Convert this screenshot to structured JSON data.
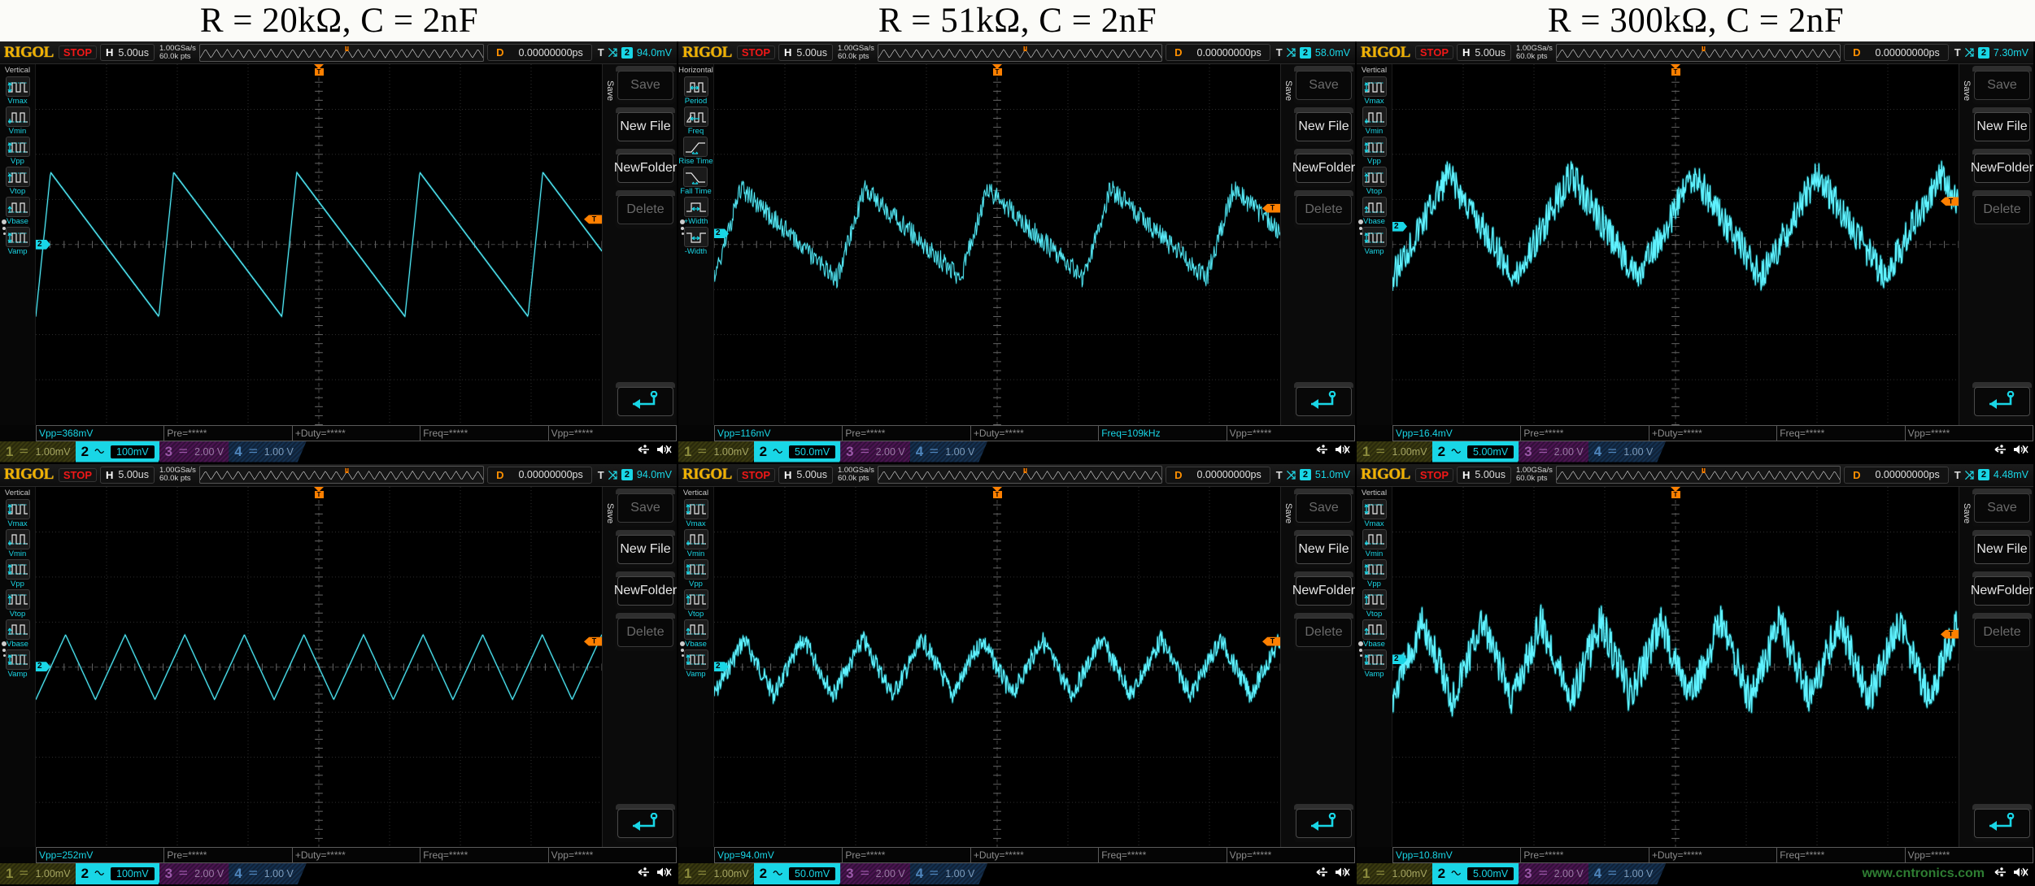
{
  "titles": [
    "R = 20kΩ, C = 2nF",
    "R = 51kΩ, C = 2nF",
    "R = 300kΩ, C = 2nF"
  ],
  "brand": "RIGOL",
  "common": {
    "run_state": "STOP",
    "h_label": "H",
    "h_value": "5.00us",
    "sample_rate": "1.00GSa/s",
    "mem_depth": "60.0k pts",
    "d_label": "D",
    "d_value": "0.00000000ps",
    "trigger_label": "T",
    "trigger_channel": "2",
    "trigger_slope": "rising-edge-icon",
    "measure_placeholder": "*****",
    "minimap_marker": "T"
  },
  "menus": {
    "vertical": {
      "title": "Vertical",
      "items": [
        {
          "label": "Vmax",
          "icon": "vmax-icon"
        },
        {
          "label": "Vmin",
          "icon": "vmin-icon"
        },
        {
          "label": "Vpp",
          "icon": "vpp-icon"
        },
        {
          "label": "Vtop",
          "icon": "vtop-icon"
        },
        {
          "label": "Vbase",
          "icon": "vbase-icon"
        },
        {
          "label": "Vamp",
          "icon": "vamp-icon"
        }
      ]
    },
    "horizontal": {
      "title": "Horizontal",
      "items": [
        {
          "label": "Period",
          "icon": "period-icon"
        },
        {
          "label": "Freq",
          "icon": "freq-icon"
        },
        {
          "label": "Rise Time",
          "icon": "rise-time-icon"
        },
        {
          "label": "Fall Time",
          "icon": "fall-time-icon"
        },
        {
          "label": "+Width",
          "icon": "pos-width-icon"
        },
        {
          "label": "-Width",
          "icon": "neg-width-icon"
        }
      ]
    },
    "save": {
      "tab": "Save",
      "keys": [
        {
          "label": "Save",
          "state": "disabled"
        },
        {
          "label": "New File",
          "state": "enabled"
        },
        {
          "label": "NewFolder",
          "state": "enabled"
        },
        {
          "label": "Delete",
          "state": "disabled"
        }
      ],
      "back_icon": "back-arrow-icon"
    }
  },
  "channels": [
    {
      "num": "1",
      "coupling": "dc-coupling-icon",
      "selected": false
    },
    {
      "num": "2",
      "coupling": "ac-coupling-icon",
      "selected": true
    },
    {
      "num": "3",
      "coupling": "dc-coupling-icon",
      "selected": false
    },
    {
      "num": "4",
      "coupling": "dc-coupling-icon",
      "selected": false
    }
  ],
  "sys_icons": [
    "usb-icon",
    "sound-mute-icon"
  ],
  "watermark": "www.cntronics.com",
  "scopes": [
    {
      "id": "scope-1",
      "position": "top-left",
      "trigger_level": "94.0mV",
      "left_menu": "vertical",
      "channel_scales": [
        "1.00mV",
        "100mV",
        "2.00 V",
        "1.00 V"
      ],
      "measurements": [
        {
          "label": "Vpp=",
          "value": "368mV",
          "active": true
        },
        {
          "label": "Pre=",
          "value": "*****",
          "active": false
        },
        {
          "label": "+Duty=",
          "value": "*****",
          "active": false
        },
        {
          "label": "Freq=",
          "value": "*****",
          "active": false
        },
        {
          "label": "Vpp=",
          "value": "*****",
          "active": false
        }
      ],
      "waveform": {
        "type": "sawtooth-falling",
        "cycles": 4.6,
        "amplitude_div": 1.6,
        "center_y": 0.5,
        "noise": 0.0,
        "thickness": 2.4,
        "duty_rise": 0.12
      }
    },
    {
      "id": "scope-2",
      "position": "top-middle",
      "trigger_level": "58.0mV",
      "left_menu": "horizontal",
      "channel_scales": [
        "1.00mV",
        "50.0mV",
        "2.00 V",
        "1.00 V"
      ],
      "measurements": [
        {
          "label": "Vpp=",
          "value": "116mV",
          "active": true
        },
        {
          "label": "Pre=",
          "value": "*****",
          "active": false
        },
        {
          "label": "+Duty=",
          "value": "*****",
          "active": false
        },
        {
          "label": "Freq=",
          "value": "109kHz",
          "active": true
        },
        {
          "label": "Vpp=",
          "value": "*****",
          "active": false
        }
      ],
      "waveform": {
        "type": "sawtooth-falling",
        "cycles": 4.6,
        "amplitude_div": 1.0,
        "center_y": 0.47,
        "noise": 0.055,
        "thickness": 2.0,
        "duty_rise": 0.22
      }
    },
    {
      "id": "scope-3",
      "position": "top-right",
      "trigger_level": "7.30mV",
      "left_menu": "vertical",
      "channel_scales": [
        "1.00mV",
        "5.00mV",
        "2.00 V",
        "1.00 V"
      ],
      "measurements": [
        {
          "label": "Vpp=",
          "value": "16.4mV",
          "active": true
        },
        {
          "label": "Pre=",
          "value": "*****",
          "active": false
        },
        {
          "label": "+Duty=",
          "value": "*****",
          "active": false
        },
        {
          "label": "Freq=",
          "value": "*****",
          "active": false
        },
        {
          "label": "Vpp=",
          "value": "*****",
          "active": false
        }
      ],
      "waveform": {
        "type": "triangle",
        "cycles": 4.6,
        "amplitude_div": 1.15,
        "center_y": 0.45,
        "noise": 0.09,
        "thickness": 3.2,
        "duty_rise": 0.45
      }
    },
    {
      "id": "scope-4",
      "position": "bottom-left",
      "trigger_level": "94.0mV",
      "left_menu": "vertical",
      "channel_scales": [
        "1.00mV",
        "100mV",
        "2.00 V",
        "1.00 V"
      ],
      "measurements": [
        {
          "label": "Vpp=",
          "value": "252mV",
          "active": true
        },
        {
          "label": "Pre=",
          "value": "*****",
          "active": false
        },
        {
          "label": "+Duty=",
          "value": "*****",
          "active": false
        },
        {
          "label": "Freq=",
          "value": "*****",
          "active": false
        },
        {
          "label": "Vpp=",
          "value": "*****",
          "active": false
        }
      ],
      "waveform": {
        "type": "triangle",
        "cycles": 9.5,
        "amplitude_div": 0.72,
        "center_y": 0.5,
        "noise": 0.0,
        "thickness": 2.2,
        "duty_rise": 0.5
      }
    },
    {
      "id": "scope-5",
      "position": "bottom-middle",
      "trigger_level": "51.0mV",
      "left_menu": "vertical",
      "channel_scales": [
        "1.00mV",
        "50.0mV",
        "2.00 V",
        "1.00 V"
      ],
      "measurements": [
        {
          "label": "Vpp=",
          "value": "94.0mV",
          "active": true
        },
        {
          "label": "Pre=",
          "value": "*****",
          "active": false
        },
        {
          "label": "+Duty=",
          "value": "*****",
          "active": false
        },
        {
          "label": "Freq=",
          "value": "*****",
          "active": false
        },
        {
          "label": "Vpp=",
          "value": "*****",
          "active": false
        }
      ],
      "waveform": {
        "type": "triangle",
        "cycles": 9.5,
        "amplitude_div": 0.62,
        "center_y": 0.5,
        "noise": 0.05,
        "thickness": 3.0,
        "duty_rise": 0.5
      }
    },
    {
      "id": "scope-6",
      "position": "bottom-right",
      "trigger_level": "4.48mV",
      "left_menu": "vertical",
      "channel_scales": [
        "1.00mV",
        "5.00mV",
        "2.00 V",
        "1.00 V"
      ],
      "measurements": [
        {
          "label": "Vpp=",
          "value": "10.8mV",
          "active": true
        },
        {
          "label": "Pre=",
          "value": "*****",
          "active": false
        },
        {
          "label": "+Duty=",
          "value": "*****",
          "active": false
        },
        {
          "label": "Freq=",
          "value": "*****",
          "active": false
        },
        {
          "label": "Vpp=",
          "value": "*****",
          "active": false
        }
      ],
      "waveform": {
        "type": "triangle",
        "cycles": 9.5,
        "amplitude_div": 0.85,
        "center_y": 0.48,
        "noise": 0.1,
        "thickness": 3.6,
        "duty_rise": 0.5
      }
    }
  ]
}
